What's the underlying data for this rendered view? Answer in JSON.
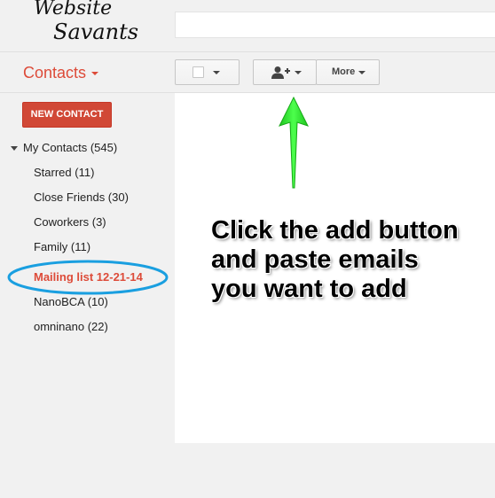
{
  "logo": {
    "line1": "Website",
    "line2": "Savants"
  },
  "header": {
    "app_title": "Contacts"
  },
  "toolbar": {
    "more_label": "More"
  },
  "sidebar": {
    "new_contact_label": "NEW CONTACT",
    "root_label": "My Contacts (545)",
    "items": [
      {
        "label": "Starred (11)"
      },
      {
        "label": "Close Friends (30)"
      },
      {
        "label": "Coworkers (3)"
      },
      {
        "label": "Family (11)"
      },
      {
        "label": "Mailing list 12-21-14"
      },
      {
        "label": "NanoBCA (10)"
      },
      {
        "label": "omninano (22)"
      }
    ]
  },
  "annotation": {
    "lines": [
      "Click the add button",
      "and paste emails",
      "you want to add"
    ]
  },
  "colors": {
    "accent": "#dd4b39",
    "button_red": "#d14836",
    "arrow": "#22dd22",
    "highlight_ring": "#1a9fe0"
  }
}
